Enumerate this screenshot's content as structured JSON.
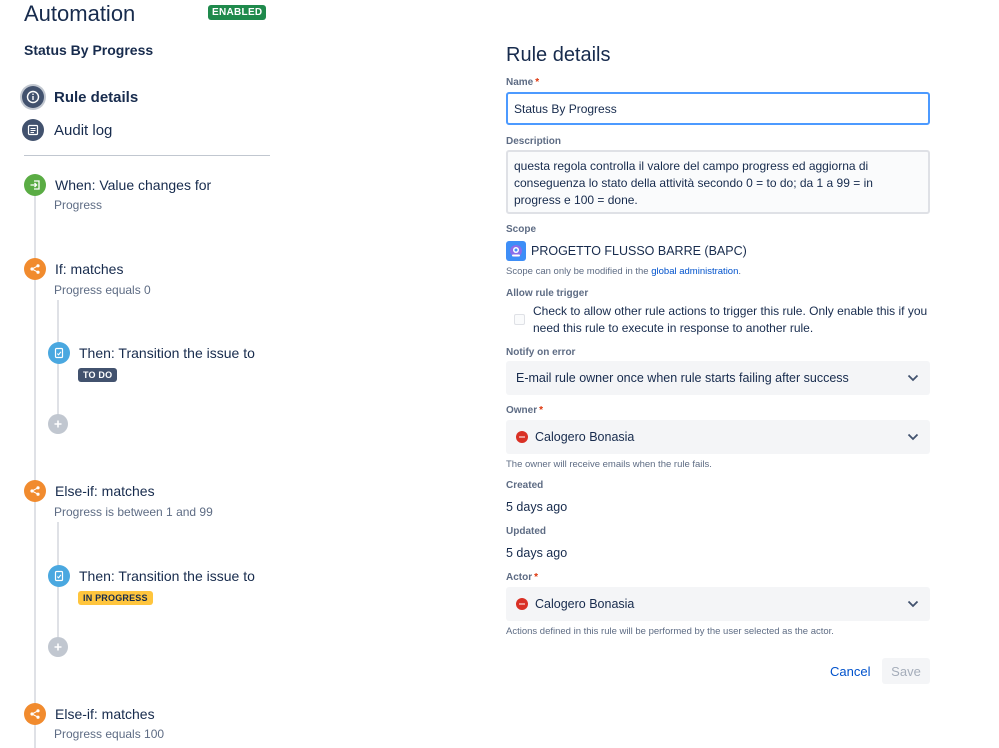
{
  "header": {
    "app_title": "Automation",
    "status_badge": "ENABLED",
    "rule_name": "Status By Progress"
  },
  "nav": {
    "items": [
      {
        "label": "Rule details",
        "icon": "info-icon",
        "active": true
      },
      {
        "label": "Audit log",
        "icon": "list-icon",
        "active": false
      }
    ]
  },
  "flow": {
    "trigger": {
      "title": "When: Value changes for",
      "subtitle": "Progress",
      "icon": "trigger-enter-icon"
    },
    "blocks": [
      {
        "condition_title": "If: matches",
        "condition_subtitle": "Progress equals 0",
        "action_title": "Then: Transition the issue to",
        "status_lozenge": "TO DO"
      },
      {
        "condition_title": "Else-if: matches",
        "condition_subtitle": "Progress is between 1 and 99",
        "action_title": "Then: Transition the issue to",
        "status_lozenge": "IN PROGRESS"
      },
      {
        "condition_title": "Else-if: matches",
        "condition_subtitle": "Progress equals 100"
      }
    ]
  },
  "details": {
    "title": "Rule details",
    "name_label": "Name",
    "name_value": "Status By Progress",
    "description_label": "Description",
    "description_value": "questa regola controlla il valore del campo progress ed aggiorna di conseguenza lo stato della attività secondo 0 = to do; da 1 a 99 = in progress e 100 = done.",
    "scope_label": "Scope",
    "scope_value": "PROGETTO FLUSSO BARRE (BAPC)",
    "scope_helper_prefix": "Scope can only be modified in the ",
    "scope_helper_link": "global administration",
    "scope_helper_suffix": ".",
    "allow_trigger_label": "Allow rule trigger",
    "allow_trigger_text": "Check to allow other rule actions to trigger this rule. Only enable this if you need this rule to execute in response to another rule.",
    "allow_trigger_checked": false,
    "notify_label": "Notify on error",
    "notify_value": "E-mail rule owner once when rule starts failing after success",
    "owner_label": "Owner",
    "owner_value": "Calogero Bonasia",
    "owner_helper": "The owner will receive emails when the rule fails.",
    "created_label": "Created",
    "created_value": "5 days ago",
    "updated_label": "Updated",
    "updated_value": "5 days ago",
    "actor_label": "Actor",
    "actor_value": "Calogero Bonasia",
    "actor_helper": "Actions defined in this rule will be performed by the user selected as the actor.",
    "cancel_label": "Cancel",
    "save_label": "Save"
  },
  "colors": {
    "enabled_badge": "#1f8a4c",
    "trigger_icon": "#5aac44",
    "condition_icon": "#f18b2e",
    "action_icon": "#4aa8e0",
    "todo_lozenge": "#42526e",
    "inprogress_lozenge": "#ffc53d",
    "link": "#0052cc",
    "input_focus": "#4c9aff"
  }
}
